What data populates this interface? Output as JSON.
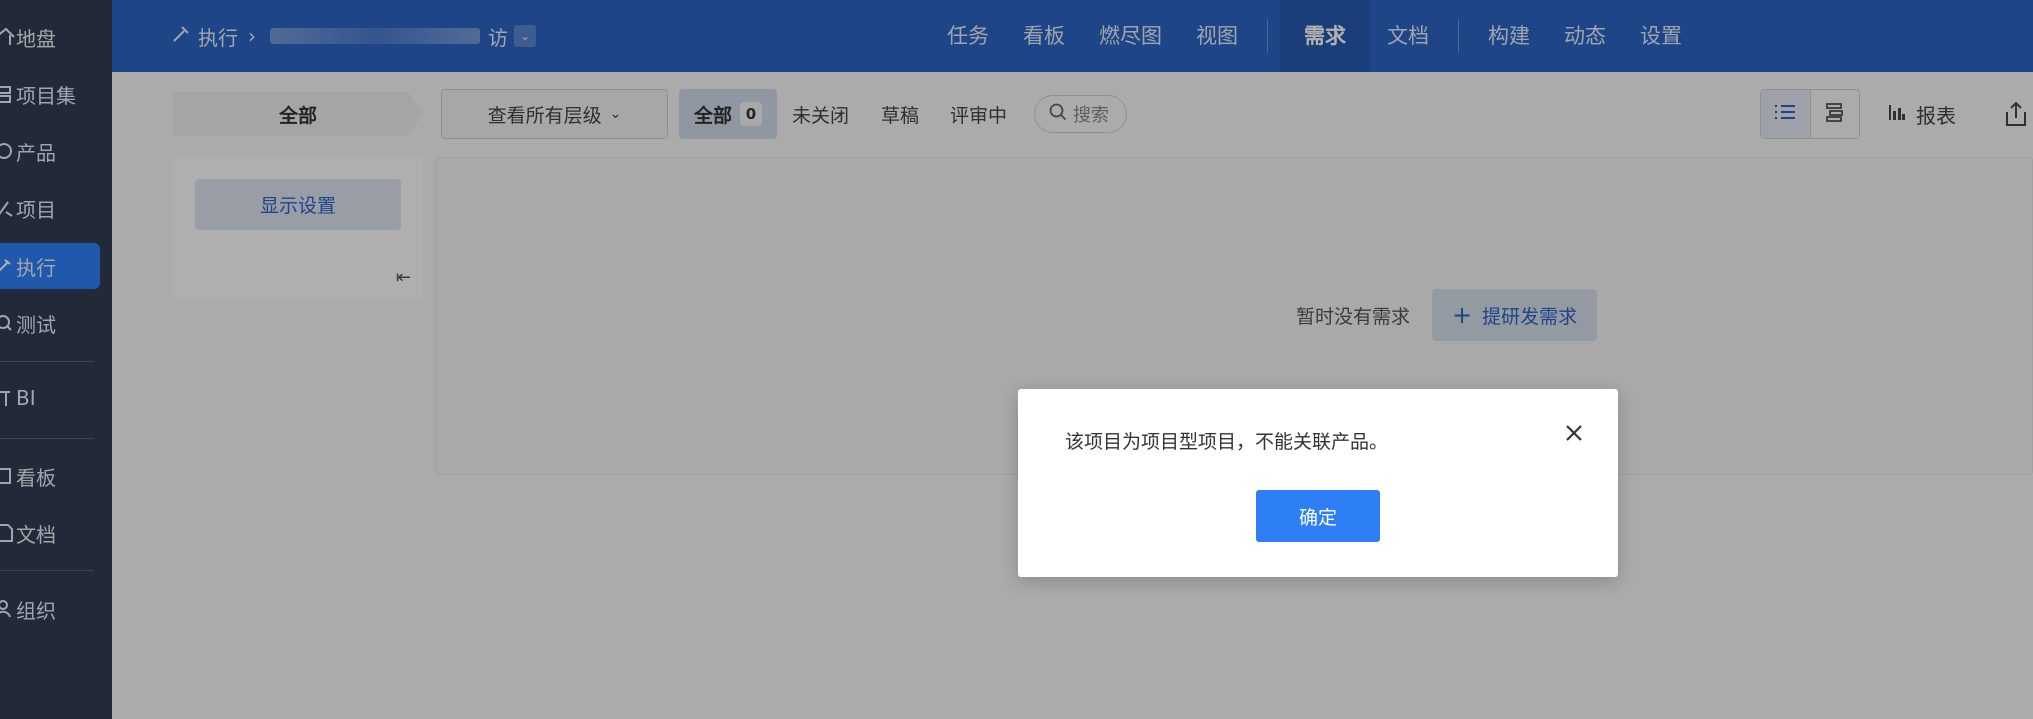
{
  "sidebar": {
    "items": [
      {
        "label": "地盘",
        "icon": "home-icon"
      },
      {
        "label": "项目集",
        "icon": "program-icon"
      },
      {
        "label": "产品",
        "icon": "product-icon"
      },
      {
        "label": "项目",
        "icon": "project-icon"
      },
      {
        "label": "执行",
        "icon": "execution-icon",
        "active": true
      },
      {
        "label": "测试",
        "icon": "test-icon"
      },
      {
        "label": "BI",
        "icon": "bi-icon"
      },
      {
        "label": "看板",
        "icon": "kanban-icon"
      },
      {
        "label": "文档",
        "icon": "doc-icon"
      },
      {
        "label": "组织",
        "icon": "org-icon"
      }
    ]
  },
  "header": {
    "breadcrumb_root": "执行",
    "breadcrumb_tail": "访",
    "nav": [
      "任务",
      "看板",
      "燃尽图",
      "视图"
    ],
    "nav_active": "需求",
    "nav_mid": [
      "文档"
    ],
    "nav_right": [
      "构建",
      "动态",
      "设置"
    ]
  },
  "toolbar": {
    "tab_all": "全部",
    "level_select": "查看所有层级",
    "filter_all": "全部",
    "filter_all_count": "0",
    "filter_unclosed": "未关闭",
    "filter_draft": "草稿",
    "filter_reviewing": "评审中",
    "search_placeholder": "搜索",
    "report": "报表"
  },
  "panel": {
    "display_settings": "显示设置"
  },
  "main": {
    "empty_text": "暂时没有需求",
    "add_button": "提研发需求"
  },
  "modal": {
    "message": "该项目为项目型项目，不能关联产品。",
    "ok": "确定"
  },
  "colors": {
    "header_bg": "#2a64c3",
    "sidebar_bg": "#313c52",
    "accent": "#2e7ef5"
  }
}
